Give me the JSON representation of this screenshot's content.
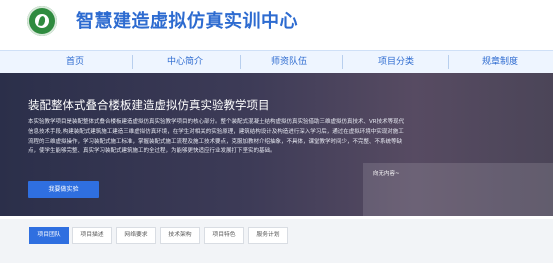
{
  "header": {
    "site_title": "智慧建造虚拟仿真实训中心"
  },
  "nav": {
    "items": [
      "首页",
      "中心简介",
      "师资队伍",
      "项目分类",
      "规章制度"
    ]
  },
  "banner": {
    "title": "装配整体式叠合楼板建造虚拟仿真实验教学项目",
    "description": "本实验教学项目是装配整体式叠合楼板建造虚拟仿真实验教学项目的核心部分。整个装配式混凝土结构虚拟仿真实验借助三维虚拟仿真技术、VR技术等现代信息技术手段,构建装配式建筑施工建造三维虚拟仿真环境，在学生对相关的实验原理，建筑结构设计及构造进行深入学习后，通过在虚拟环境中实现对施工流程的三维虚拟操作，学习装配式施工标准，掌握装配式施工流程及施工技术要点，克服加教材介绍抽象，不具体，课堂教学时间少，不完整、不系统等缺点，使学生能够完整、真实学习装配式建筑施工的全过程，为能够更快适应行业发展打下坚实的基础。",
    "button_label": "我要做实验",
    "side_label": "向无内容~"
  },
  "tabs": [
    {
      "label": "项目团队",
      "active": true
    },
    {
      "label": "项目描述",
      "active": false
    },
    {
      "label": "网络要求",
      "active": false
    },
    {
      "label": "技术架构",
      "active": false
    },
    {
      "label": "项目特色",
      "active": false
    },
    {
      "label": "服务计划",
      "active": false
    }
  ],
  "colors": {
    "brand_blue": "#2d6bd0",
    "button_blue": "#2f6fe0",
    "logo_green": "#2f8b3f"
  }
}
